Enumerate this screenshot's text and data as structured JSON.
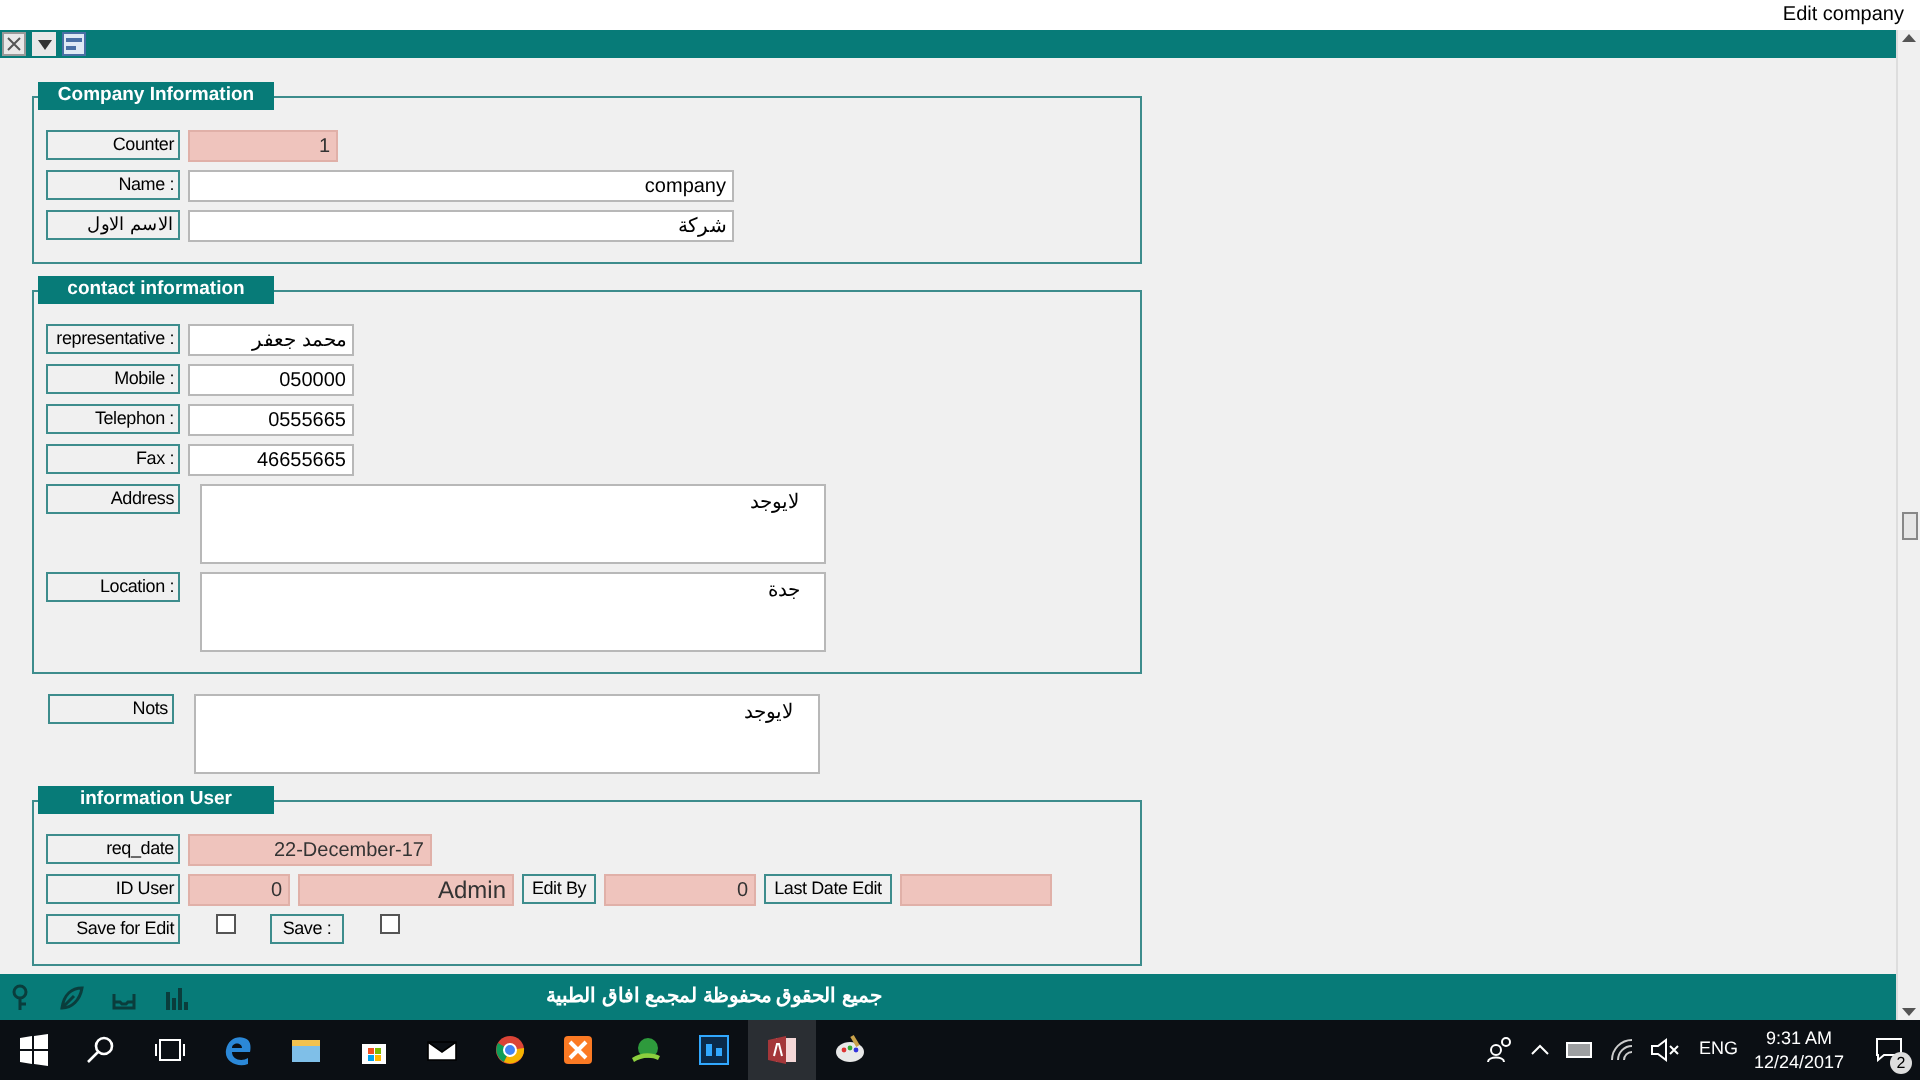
{
  "window": {
    "title": "Edit company"
  },
  "sections": [
    {
      "kind": "group",
      "legend": "Company Information",
      "rows": [
        [
          {
            "kind": "label",
            "text": "Counter"
          },
          {
            "kind": "locked-s",
            "text": "1"
          }
        ],
        [
          {
            "kind": "label",
            "text": "Name :"
          },
          {
            "kind": "field-l",
            "text": "company"
          }
        ],
        [
          {
            "kind": "label",
            "text": "الاسم الاول"
          },
          {
            "kind": "field-l",
            "text": "شركة"
          }
        ]
      ]
    },
    {
      "kind": "group",
      "legend": "contact information",
      "rows": [
        [
          {
            "kind": "label",
            "text": "representative :"
          },
          {
            "kind": "field-s",
            "text": "محمد جعفر"
          }
        ],
        [
          {
            "kind": "label",
            "text": "Mobile :"
          },
          {
            "kind": "field-s",
            "text": "050000"
          }
        ],
        [
          {
            "kind": "label",
            "text": "Telephon :"
          },
          {
            "kind": "field-s",
            "text": "0555665"
          }
        ],
        [
          {
            "kind": "label",
            "text": "Fax :"
          },
          {
            "kind": "field-s",
            "text": "46655665"
          }
        ],
        [
          {
            "kind": "label",
            "text": "Address"
          },
          {
            "kind": "memo",
            "text": "لايوجد"
          }
        ],
        [
          {
            "kind": "label",
            "text": "Location :"
          },
          {
            "kind": "memo",
            "text": "جدة"
          }
        ]
      ]
    },
    {
      "kind": "loose",
      "rows": [
        [
          {
            "kind": "label",
            "text": "Nots"
          },
          {
            "kind": "memo",
            "text": "لايوجد"
          }
        ]
      ]
    },
    {
      "kind": "group",
      "legend": "information User",
      "rows": [
        [
          {
            "kind": "label",
            "text": "req_date"
          },
          {
            "kind": "locked-m",
            "text": "22-December-17"
          }
        ],
        [
          {
            "kind": "label",
            "text": "ID User"
          },
          {
            "kind": "locked-xs",
            "text": "0"
          },
          {
            "kind": "locked-l",
            "text": "Admin"
          },
          {
            "kind": "label-s",
            "text": "Edit By"
          },
          {
            "kind": "locked-n",
            "text": "0"
          },
          {
            "kind": "label-m",
            "text": "Last Date Edit"
          },
          {
            "kind": "locked-n"
          }
        ],
        [
          {
            "kind": "label",
            "text": "Save for Edit"
          },
          {
            "kind": "checkbox",
            "checked": false
          },
          {
            "kind": "label-s",
            "text": "Save :"
          },
          {
            "kind": "checkbox",
            "checked": false
          }
        ]
      ]
    }
  ],
  "footer": {
    "text": "جميع الحقوق محفوظة لمجمع افاق الطبية"
  },
  "tray": {
    "language": "ENG",
    "time": "9:31 AM",
    "date": "12/24/2017",
    "notifications": "2"
  }
}
